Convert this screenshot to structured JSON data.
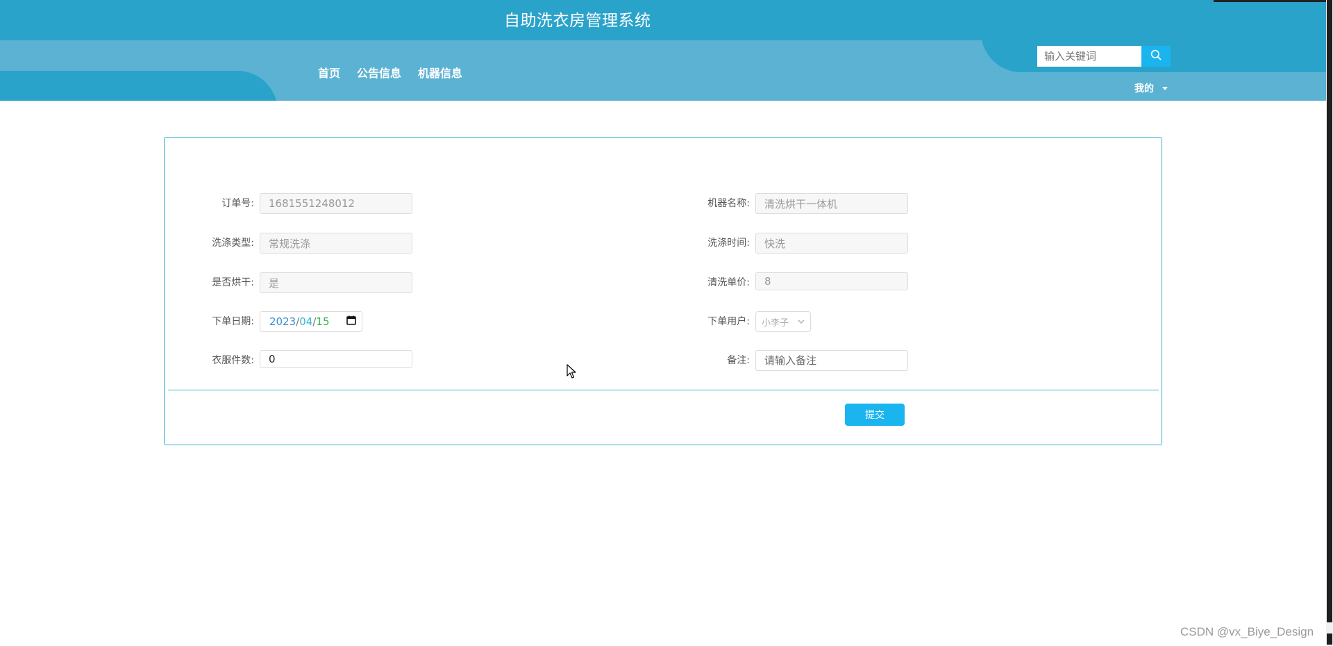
{
  "header": {
    "title": "自助洗衣房管理系统",
    "nav": [
      "首页",
      "公告信息",
      "机器信息"
    ],
    "search_placeholder": "输入关键词",
    "user_menu": "我的"
  },
  "form": {
    "order_no": {
      "label": "订单号:",
      "value": "1681551248012"
    },
    "machine_name": {
      "label": "机器名称:",
      "value": "清洗烘干一体机"
    },
    "wash_type": {
      "label": "洗涤类型:",
      "value": "常规洗涤"
    },
    "wash_time": {
      "label": "洗涤时间:",
      "value": "快洗"
    },
    "dry": {
      "label": "是否烘干:",
      "value": "是"
    },
    "unit_price": {
      "label": "清洗单价:",
      "value": "8"
    },
    "order_date": {
      "label": "下单日期:",
      "year": "2023",
      "month": "04",
      "day": "15",
      "sep": "/"
    },
    "order_user": {
      "label": "下单用户:",
      "value": "小李子"
    },
    "clothes_count": {
      "label": "衣服件数:",
      "value": "0"
    },
    "remark": {
      "label": "备注:",
      "placeholder": "请输入备注"
    },
    "submit": "提交"
  },
  "watermark": "CSDN @vx_Biye_Design",
  "colors": {
    "header_dark": "#2aa3cb",
    "header_light": "#5bb2d3",
    "accent": "#1ab5ee",
    "border": "#36b1d0"
  },
  "icons": {
    "search": "search-icon",
    "calendar": "calendar-icon",
    "dropdown": "chevron-down-icon",
    "user_caret": "caret-down-icon"
  }
}
